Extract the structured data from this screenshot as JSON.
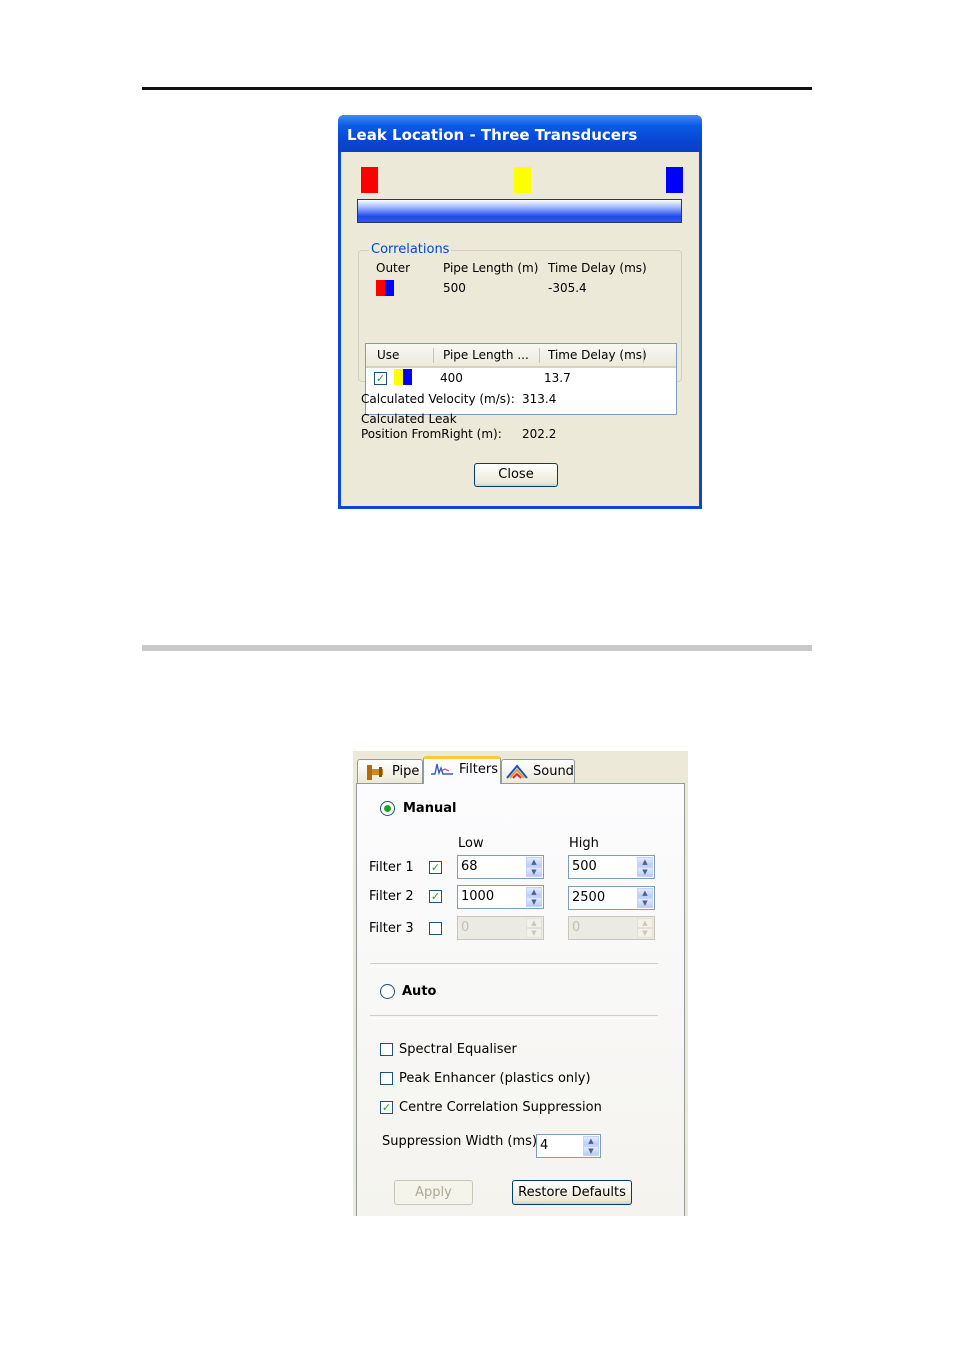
{
  "dialog": {
    "title": "Leak Location - Three Transducers",
    "marker_colors": [
      "#ff0000",
      "#ffff00",
      "#0000ff"
    ],
    "correlations": {
      "legend": "Correlations",
      "outer_header": "Outer",
      "pipe_length_header": "Pipe Length (m)",
      "time_delay_header": "Time Delay (ms)",
      "pipe_length": "500",
      "time_delay": "-305.4",
      "table": {
        "columns": [
          "Use",
          "Pipe Length ...",
          "Time Delay (ms)"
        ],
        "rows": [
          {
            "checked": true,
            "pipe_length": "400",
            "time_delay": "13.7"
          }
        ]
      }
    },
    "velocity_label": "Calculated Velocity (m/s):",
    "velocity_value": "313.4",
    "leak_label_line1": "Calculated Leak",
    "leak_label_line2": "Position FromRight (m):",
    "leak_value": "202.2",
    "close_label": "Close"
  },
  "filters_panel": {
    "tabs": [
      {
        "label": "Pipe",
        "icon": "pipe-icon"
      },
      {
        "label": "Filters",
        "icon": "waveform-icon"
      },
      {
        "label": "Sound",
        "icon": "sound-icon"
      }
    ],
    "active_tab": "Filters",
    "manual_label": "Manual",
    "manual_selected": true,
    "low_header": "Low",
    "high_header": "High",
    "filters": [
      {
        "label": "Filter 1",
        "checked": true,
        "low": "68",
        "high": "500",
        "enabled": true
      },
      {
        "label": "Filter 2",
        "checked": true,
        "low": "1000",
        "high": "2500",
        "enabled": true
      },
      {
        "label": "Filter 3",
        "checked": false,
        "low": "0",
        "high": "0",
        "enabled": false
      }
    ],
    "auto_label": "Auto",
    "options": [
      {
        "label": "Spectral Equaliser",
        "checked": false
      },
      {
        "label": "Peak Enhancer (plastics only)",
        "checked": false
      },
      {
        "label": "Centre Correlation Suppression",
        "checked": true
      }
    ],
    "suppression_label": "Suppression Width (ms)",
    "suppression_value": "4",
    "apply_label": "Apply",
    "restore_label": "Restore Defaults"
  }
}
